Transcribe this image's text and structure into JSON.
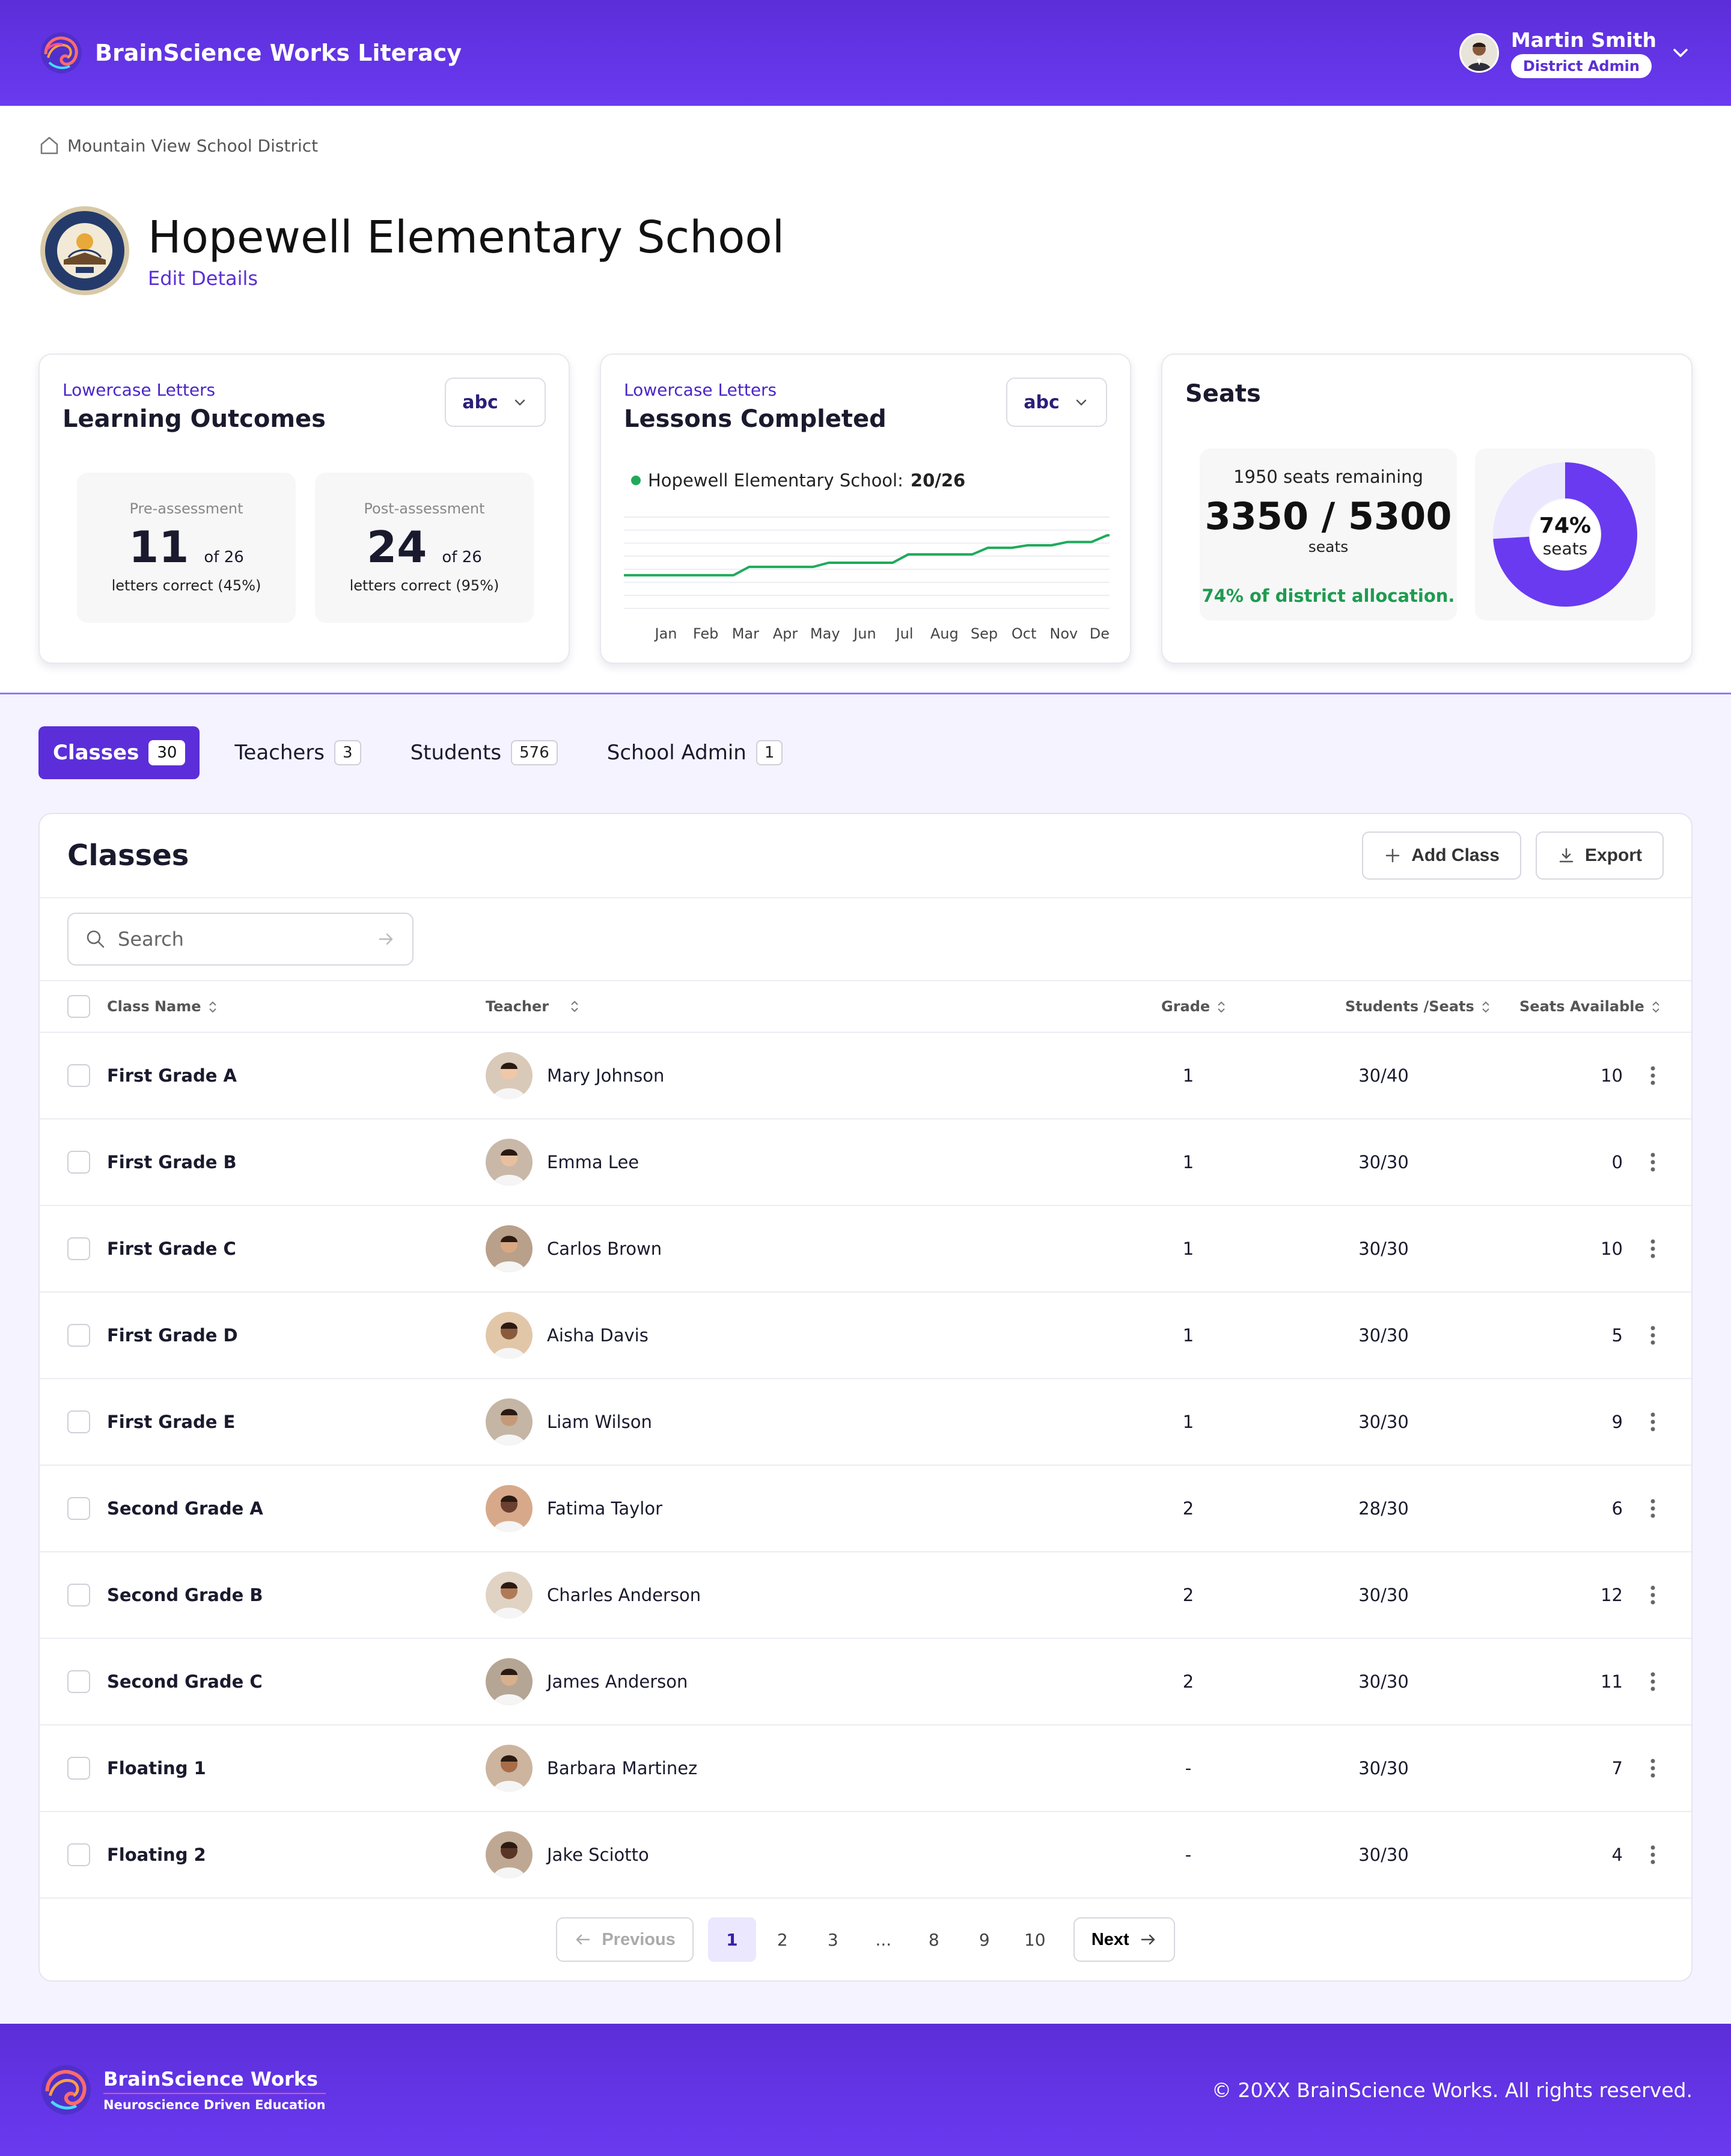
{
  "app": {
    "name": "BrainScience Works Literacy"
  },
  "user": {
    "name": "Martin Smith",
    "role": "District Admin"
  },
  "breadcrumb": {
    "district": "Mountain View School District"
  },
  "school": {
    "name": "Hopewell Elementary School",
    "edit_label": "Edit Details"
  },
  "outcomes_card": {
    "kicker": "Lowercase Letters",
    "title": "Learning Outcomes",
    "selector": "abc",
    "pre": {
      "label": "Pre-assessment",
      "value": "11",
      "of": "of 26",
      "caption": "letters correct  (45%)"
    },
    "post": {
      "label": "Post-assessment",
      "value": "24",
      "of": "of 26",
      "caption": "letters correct  (95%)"
    }
  },
  "lessons_card": {
    "kicker": "Lowercase Letters",
    "title": "Lessons Completed",
    "selector": "abc",
    "legend_label": "Hopewell Elementary School:",
    "legend_value": "20/26",
    "line_color": "#1faa5b"
  },
  "seats_card": {
    "title": "Seats",
    "remaining": "1950 seats remaining",
    "used_total": "3350 / 5300",
    "unit": "seats",
    "allocation": "74% of district allocation.",
    "donut_pct_label": "74%",
    "donut_unit": "seats",
    "donut_fraction": 0.74,
    "fill_color": "#6a3af0",
    "track_color": "#ebe7ff"
  },
  "chart_data": {
    "type": "line",
    "x": [
      "Jan",
      "Feb",
      "Mar",
      "Apr",
      "May",
      "Jun",
      "Jul",
      "Aug",
      "Sep",
      "Oct",
      "Nov",
      "Dec"
    ],
    "series": [
      {
        "values": [
          14,
          14,
          15,
          15,
          15.5,
          15.5,
          16.5,
          16.5,
          17.3,
          17.6,
          18,
          18.8
        ],
        "shape": "step"
      }
    ],
    "ylim": [
      10,
      21
    ],
    "grid": true
  },
  "tabs": [
    {
      "label": "Classes",
      "count": "30"
    },
    {
      "label": "Teachers",
      "count": "3"
    },
    {
      "label": "Students",
      "count": "576"
    },
    {
      "label": "School Admin",
      "count": "1"
    }
  ],
  "classes": {
    "title": "Classes",
    "add_label": "Add Class",
    "export_label": "Export",
    "search_placeholder": "Search",
    "columns": {
      "name": "Class Name",
      "teacher": "Teacher",
      "grade": "Grade",
      "seats": "Students /Seats",
      "available": "Seats Available"
    },
    "rows": [
      {
        "name": "First Grade A",
        "teacher": "Mary Johnson",
        "grade": "1",
        "seats": "30/40",
        "available": "10"
      },
      {
        "name": "First Grade B",
        "teacher": "Emma Lee",
        "grade": "1",
        "seats": "30/30",
        "available": "0"
      },
      {
        "name": "First Grade C",
        "teacher": "Carlos Brown",
        "grade": "1",
        "seats": "30/30",
        "available": "10"
      },
      {
        "name": "First Grade D",
        "teacher": "Aisha Davis",
        "grade": "1",
        "seats": "30/30",
        "available": "5"
      },
      {
        "name": "First Grade E",
        "teacher": "Liam Wilson",
        "grade": "1",
        "seats": "30/30",
        "available": "9"
      },
      {
        "name": "Second Grade A",
        "teacher": "Fatima Taylor",
        "grade": "2",
        "seats": "28/30",
        "available": "6"
      },
      {
        "name": "Second Grade B",
        "teacher": "Charles Anderson",
        "grade": "2",
        "seats": "30/30",
        "available": "12"
      },
      {
        "name": "Second Grade C",
        "teacher": "James Anderson",
        "grade": "2",
        "seats": "30/30",
        "available": "11"
      },
      {
        "name": "Floating 1",
        "teacher": "Barbara Martinez",
        "grade": "-",
        "seats": "30/30",
        "available": "7"
      },
      {
        "name": "Floating 2",
        "teacher": "Jake Sciotto",
        "grade": "-",
        "seats": "30/30",
        "available": "4"
      }
    ]
  },
  "pagination": {
    "previous": "Previous",
    "next": "Next",
    "pages": [
      "1",
      "2",
      "3",
      "...",
      "8",
      "9",
      "10"
    ],
    "current": "1"
  },
  "footer": {
    "brand": "BrainScience Works",
    "tagline": "Neuroscience Driven Education",
    "copyright": "© 20XX BrainScience Works. All rights reserved."
  }
}
